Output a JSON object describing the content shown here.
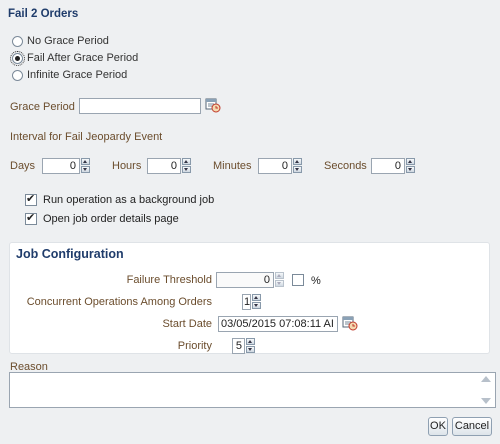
{
  "dialog": {
    "title": "Fail 2 Orders"
  },
  "grace_options": [
    {
      "label": "No Grace Period",
      "selected": false
    },
    {
      "label": "Fail After Grace Period",
      "selected": true
    },
    {
      "label": "Infinite Grace Period",
      "selected": false
    }
  ],
  "grace_period": {
    "label": "Grace Period",
    "value": ""
  },
  "interval": {
    "label": "Interval for Fail Jeopardy Event",
    "days": {
      "label": "Days",
      "value": "0"
    },
    "hours": {
      "label": "Hours",
      "value": "0"
    },
    "minutes": {
      "label": "Minutes",
      "value": "0"
    },
    "seconds": {
      "label": "Seconds",
      "value": "0"
    }
  },
  "options": {
    "background_job": {
      "label": "Run operation as a background job",
      "checked": true
    },
    "open_details": {
      "label": "Open job order details page",
      "checked": true
    }
  },
  "job_config": {
    "title": "Job Configuration",
    "failure_threshold": {
      "label": "Failure Threshold",
      "value": "0",
      "percent_label": "%",
      "percent_checked": false
    },
    "concurrent": {
      "label": "Concurrent Operations Among Orders",
      "value": "1"
    },
    "start_date": {
      "label": "Start Date",
      "value": "03/05/2015 07:08:11 AI"
    },
    "priority": {
      "label": "Priority",
      "value": "5"
    }
  },
  "reason": {
    "label": "Reason",
    "value": ""
  },
  "buttons": {
    "ok": "OK",
    "cancel": "Cancel"
  },
  "colors": {
    "title": "#1f3c6b",
    "label": "#6b4d2d",
    "background": "#eef0f2"
  }
}
